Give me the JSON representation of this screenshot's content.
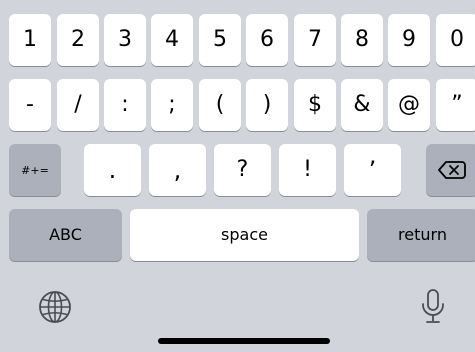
{
  "keyboard": {
    "row1": [
      "1",
      "2",
      "3",
      "4",
      "5",
      "6",
      "7",
      "8",
      "9",
      "0"
    ],
    "row2": [
      "-",
      "/",
      ":",
      ";",
      "(",
      ")",
      "$",
      "&",
      "@",
      "”"
    ],
    "row3": [
      ".",
      ",",
      "?",
      "!",
      "’"
    ],
    "more_symbols_label": "#+=",
    "abc_label": "ABC",
    "space_label": "space",
    "return_label": "return"
  },
  "icons": {
    "delete": "delete-backspace-icon",
    "globe": "globe-icon",
    "mic": "microphone-icon"
  },
  "colors": {
    "background": "#d1d4da",
    "key": "#ffffff",
    "function_key": "#abb0bb"
  }
}
